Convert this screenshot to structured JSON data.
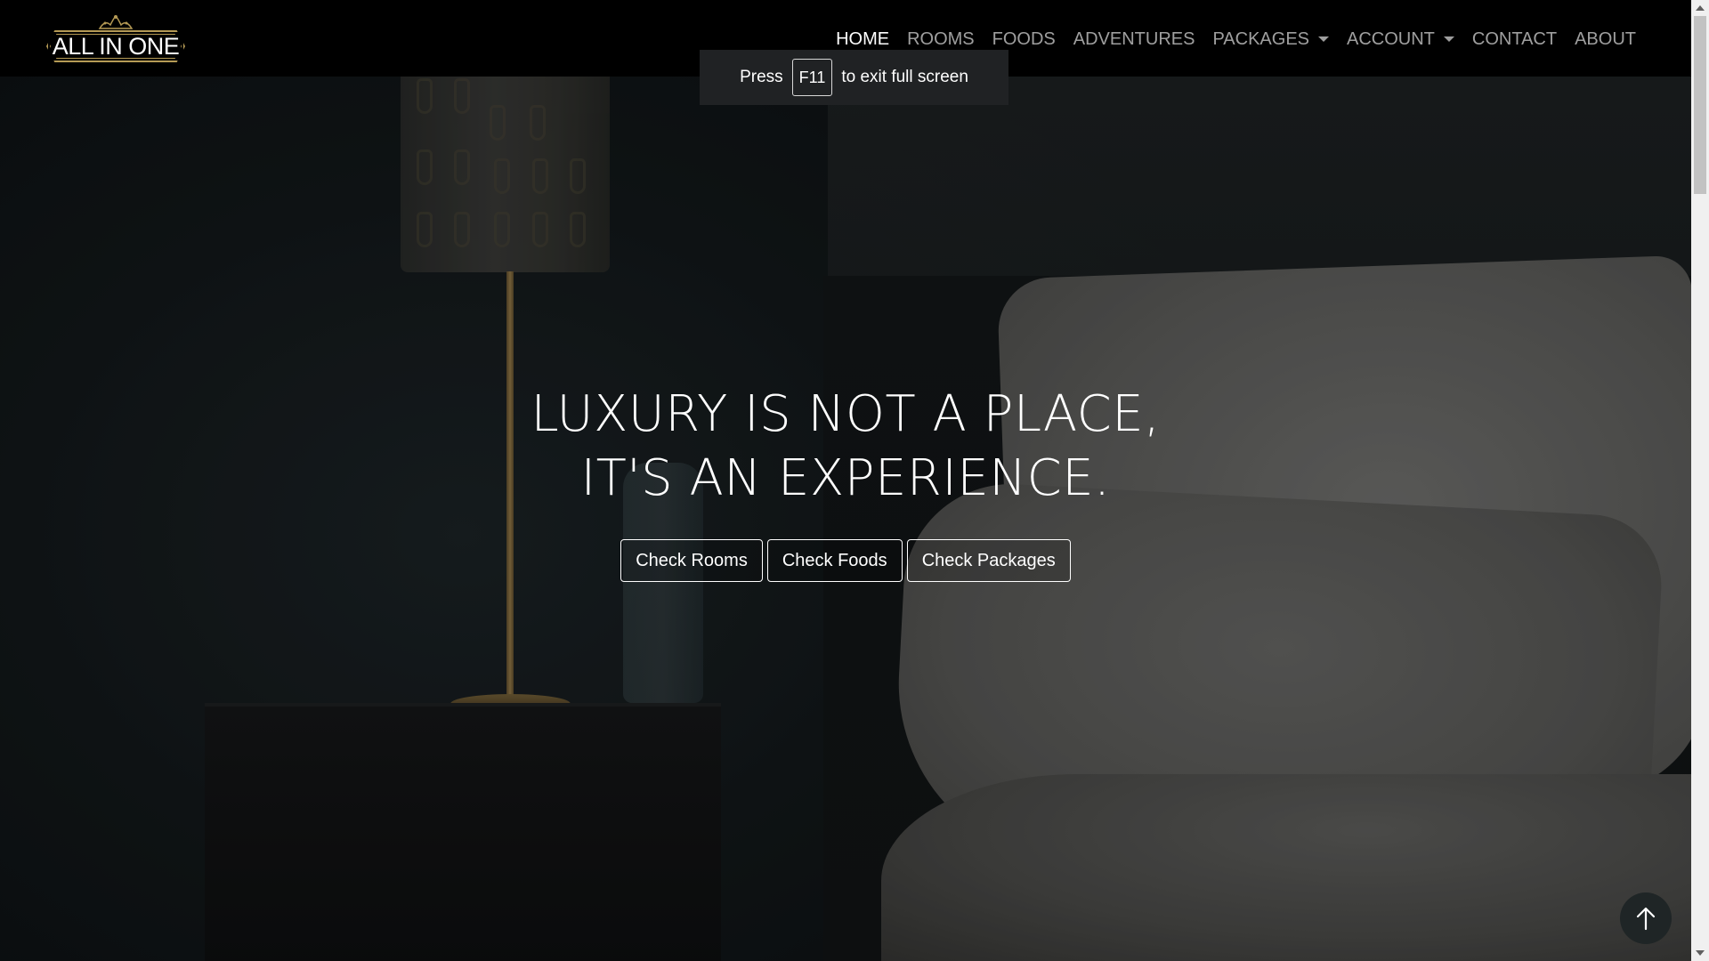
{
  "brand": {
    "logo_text": "ALL IN ONE"
  },
  "nav": {
    "items": [
      {
        "label": "HOME"
      },
      {
        "label": "ROOMS"
      },
      {
        "label": "FOODS"
      },
      {
        "label": "ADVENTURES"
      },
      {
        "label": "PACKAGES"
      },
      {
        "label": "ACCOUNT"
      },
      {
        "label": "CONTACT"
      },
      {
        "label": "ABOUT"
      }
    ]
  },
  "fullscreen_notice": {
    "prefix": "Press",
    "key": "F11",
    "suffix": "to exit full screen"
  },
  "hero": {
    "headline_line1": "LUXURY IS NOT A PLACE,",
    "headline_line2": "IT'S AN EXPERIENCE.",
    "buttons": [
      {
        "label": "Check Rooms"
      },
      {
        "label": "Check Foods"
      },
      {
        "label": "Check Packages"
      }
    ]
  },
  "icons": {
    "back_to_top": "arrow-up-icon",
    "dropdown": "caret-down-icon",
    "logo": "crown-icon"
  },
  "colors": {
    "navbar": "#000000",
    "nav_active": "#ffffff",
    "nav_inactive": "#9e9e9e",
    "logo_gold": "#b59a55"
  }
}
